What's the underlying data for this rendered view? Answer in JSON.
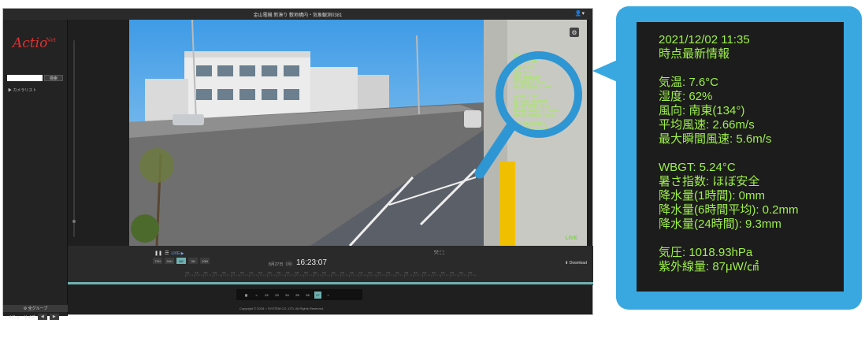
{
  "window": {
    "title": "金山電機 新湊り 敷地構内・気象観測0381",
    "user_icon": "user-icon"
  },
  "sidebar": {
    "logo_text": "Actio",
    "logo_net": "Net",
    "search_placeholder": "",
    "search_button": "検索",
    "camera_list": "▶ カメラリスト",
    "group_button": "⚙ 全グループ",
    "menu_size_label": "メニューサイズ",
    "prev": "◀",
    "next": "▶"
  },
  "camera": {
    "live": "LIVE",
    "overlay_lines": [
      "2021/12/02 11:35",
      "時点最新情報",
      "気温: 7.6°C",
      "湿度: 62%",
      "風向: 南東(134°)",
      "平均風速: 2.66m/s",
      "最大瞬間風速: 5.6m/s",
      "WBGT: 5.24°C",
      "暑さ指数: ほぼ安全",
      "降水量(1時間): 0mm",
      "降水量(6時間平均): 0.2mm",
      "降水量(24時間): 9.3mm",
      "気圧: 1018.93hPa",
      "紫外線量: 87μW/㎠"
    ]
  },
  "controls": {
    "pause": "❚❚",
    "list_icon": "☰",
    "live_label": "LIVE ▶",
    "zoom": [
      "72H",
      "24H",
      "6H",
      "3H",
      "10M"
    ],
    "zoom_active_index": 2,
    "date": "8月27日（月）",
    "time": "16:23:07",
    "download": "⬇ Download",
    "expand": "⤧ ⛶",
    "timeline_ticks": [
      "14:00",
      "14:10",
      "14:20",
      "14:30",
      "14:40",
      "14:50",
      "15:00",
      "15:10",
      "15:20",
      "15:30",
      "15:40",
      "15:50",
      "16:00",
      "16:10",
      "16:20",
      "16:30",
      "16:40",
      "16:50",
      "17:00",
      "17:10",
      "17:20",
      "17:30",
      "17:40",
      "17:50",
      "18:00",
      "18:10",
      "18:20",
      "18:30",
      "18:40",
      "18:50",
      "19:00",
      "19:10"
    ]
  },
  "pager": {
    "calendar": "▦",
    "prev": "<",
    "pages": [
      "22",
      "23",
      "24",
      "25",
      "26",
      "27"
    ],
    "active_index": 5,
    "next": ">"
  },
  "footer": {
    "copyright": "Copyright © 2018 ○ SYSTEM CO.,LTD. All Rights Reserved."
  },
  "info_panel": {
    "lines_block1": [
      "2021/12/02 11:35",
      "時点最新情報"
    ],
    "lines_block2": [
      "気温: 7.6°C",
      "湿度: 62%",
      "風向: 南東(134°)",
      "平均風速: 2.66m/s",
      "最大瞬間風速: 5.6m/s"
    ],
    "lines_block3": [
      "WBGT: 5.24°C",
      "暑さ指数: ほぼ安全",
      "降水量(1時間): 0mm",
      "降水量(6時間平均): 0.2mm",
      "降水量(24時間): 9.3mm"
    ],
    "lines_block4": [
      "気圧: 1018.93hPa",
      "紫外線量: 87μW/㎠"
    ]
  },
  "colors": {
    "accent": "#6fb0b0",
    "panel_blue": "#39a8e0",
    "text_green": "#9ef04a"
  }
}
